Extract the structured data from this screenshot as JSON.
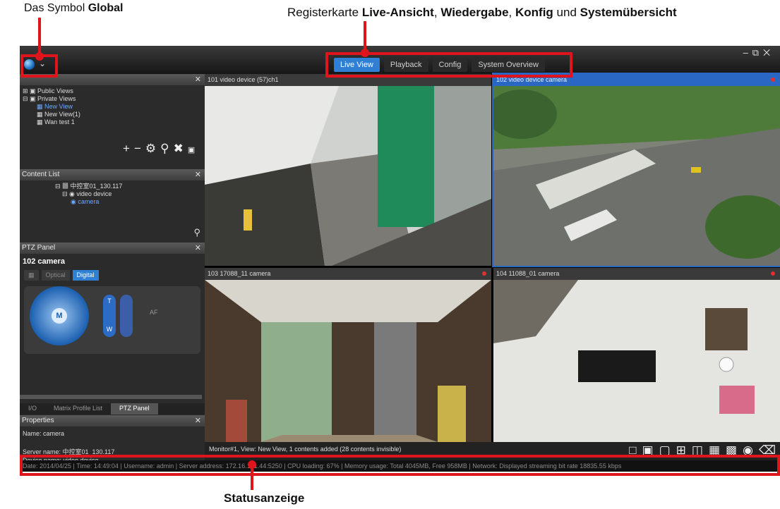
{
  "annotations": {
    "global": {
      "prefix": "Das Symbol ",
      "bold": "Global"
    },
    "tabs": {
      "prefix": "Registerkarte ",
      "b1": "Live-Ansicht",
      "s1": ", ",
      "b2": "Wiedergabe",
      "s2": ", ",
      "b3": "Konfig",
      "s3": " und ",
      "b4": "Systemübersicht"
    },
    "status": "Statusanzeige"
  },
  "tabs": [
    "Live View",
    "Playback",
    "Config",
    "System Overview"
  ],
  "view_panel": {
    "items": [
      "Public Views",
      "Private Views",
      "New View",
      "New View(1)",
      "Wan test 1"
    ]
  },
  "content_list": {
    "title": "Content List",
    "items": [
      "中控室01_130.117",
      "video device",
      "camera"
    ]
  },
  "ptz": {
    "title": "PTZ Panel",
    "camera": "102  camera",
    "mode_optical": "Optical",
    "mode_digital": "Digital",
    "center": "M",
    "zoom_t": "T",
    "zoom_w": "W",
    "af": "AF"
  },
  "bottom_tabs": [
    "I/O",
    "Matrix Profile List",
    "PTZ Panel"
  ],
  "properties": {
    "title": "Properties",
    "name": "Name: camera",
    "server": "Server name: 中控室01_130.117",
    "device": "Device name: video device"
  },
  "cells": [
    "101  video device  (57)ch1",
    "102  video device  camera",
    "103  17088_11  camera",
    "104  11088_01  camera"
  ],
  "monitor_text": "Monitor#1, View: New View, 1 contents added (28 contents invisible)",
  "status_text": "Date: 2014/04/25  |  Time: 14:49:04  |  Username: admin  |  Server address: 172.16.101.44:5250  |  CPU loading: 67%  |  Memory usage: Total 4045MB, Free 958MB  |  Network: Displayed streaming bit rate 18835.55 kbps"
}
